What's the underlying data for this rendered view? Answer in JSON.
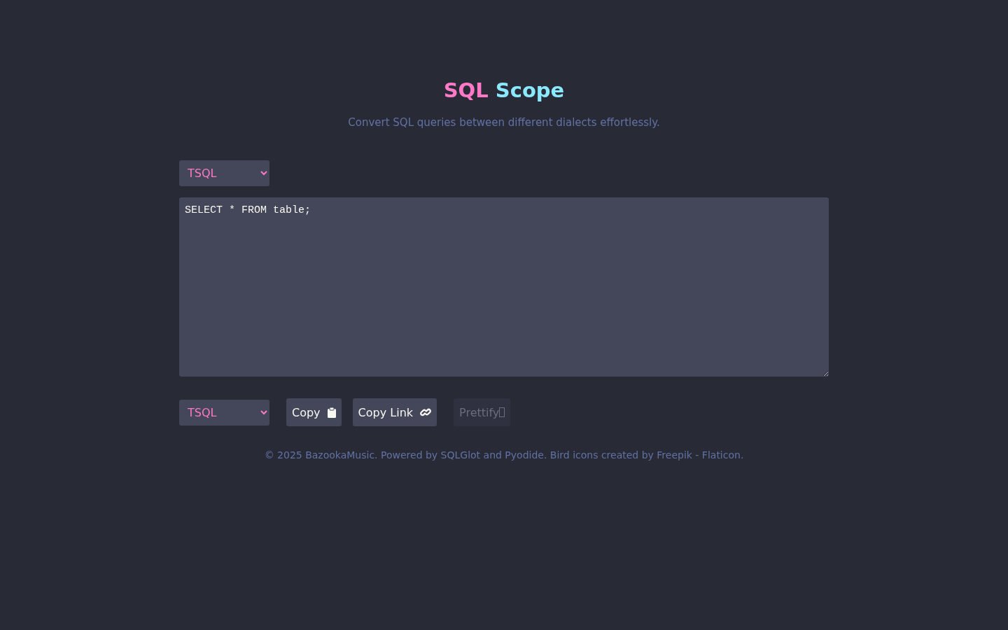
{
  "header": {
    "title_part_1": "SQL",
    "title_part_2": "Scope",
    "subtitle": "Convert SQL queries between different dialects effortlessly."
  },
  "source_dialect": {
    "value": "TSQL"
  },
  "editor": {
    "value": "SELECT * FROM table;"
  },
  "target_dialect": {
    "value": "TSQL"
  },
  "buttons": [
    {
      "kind": "copy",
      "label": "Copy",
      "disabled": false
    },
    {
      "kind": "link",
      "label": "Copy Link",
      "disabled": false
    },
    {
      "kind": "glyph",
      "label": "Prettify",
      "disabled": true
    }
  ],
  "footer": "© 2025 BazookaMusic. Powered by SQLGlot and Pyodide. Bird icons created by Freepik - Flaticon."
}
